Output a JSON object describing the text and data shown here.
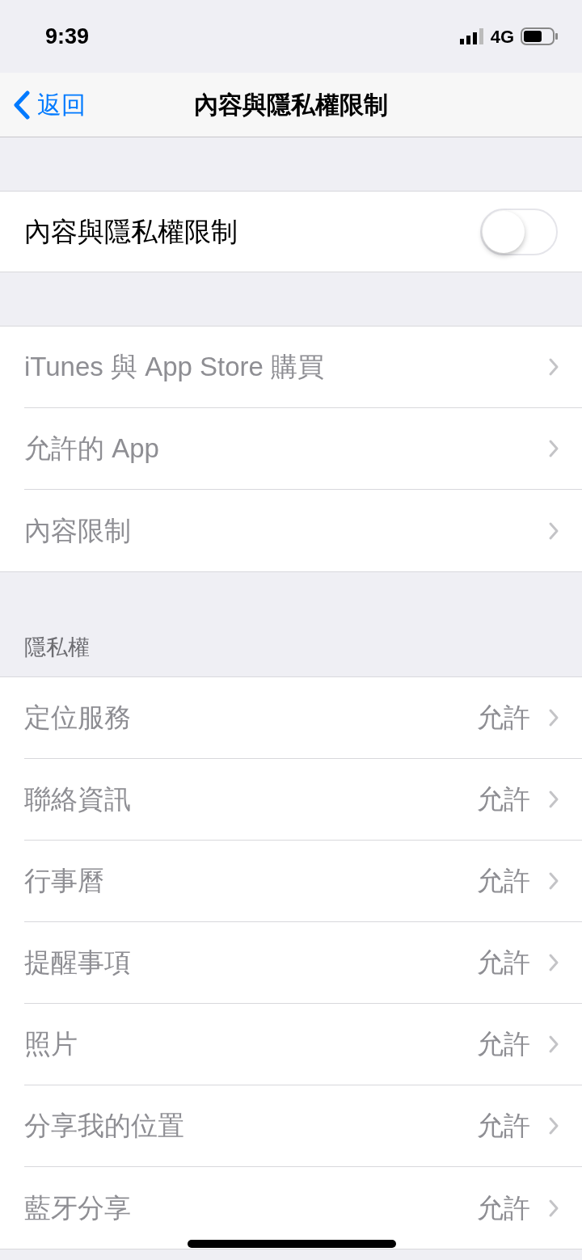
{
  "status_bar": {
    "time": "9:39",
    "network": "4G"
  },
  "nav": {
    "back": "返回",
    "title": "內容與隱私權限制"
  },
  "master": {
    "label": "內容與隱私權限制",
    "on": false
  },
  "store_group": [
    {
      "label": "iTunes 與 App Store 購買",
      "disabled": true
    },
    {
      "label": "允許的 App",
      "disabled": true
    },
    {
      "label": "內容限制",
      "disabled": true
    }
  ],
  "privacy": {
    "header": "隱私權",
    "rows": [
      {
        "label": "定位服務",
        "value": "允許",
        "disabled": true
      },
      {
        "label": "聯絡資訊",
        "value": "允許",
        "disabled": true
      },
      {
        "label": "行事曆",
        "value": "允許",
        "disabled": true
      },
      {
        "label": "提醒事項",
        "value": "允許",
        "disabled": true
      },
      {
        "label": "照片",
        "value": "允許",
        "disabled": true
      },
      {
        "label": "分享我的位置",
        "value": "允許",
        "disabled": true
      },
      {
        "label": "藍牙分享",
        "value": "允許",
        "disabled": true
      }
    ]
  }
}
